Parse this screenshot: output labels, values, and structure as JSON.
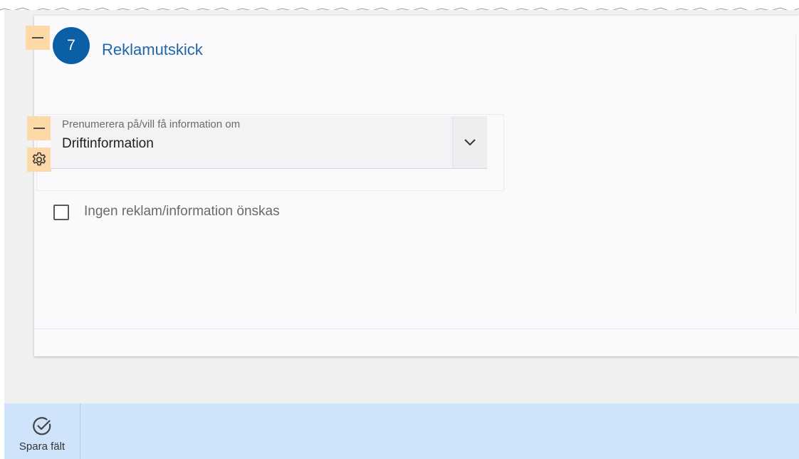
{
  "section": {
    "step_number": "7",
    "title": "Reklamutskick"
  },
  "subscription_select": {
    "label": "Prenumerera på/vill få information om",
    "value": "Driftinformation"
  },
  "opt_out": {
    "label": "Ingen reklam/information önskas",
    "checked": false
  },
  "footer": {
    "save_label": "Spara fält"
  },
  "icons": {
    "collapse_section": "minus-icon",
    "collapse_field": "minus-icon",
    "field_settings": "gear-icon",
    "dropdown": "chevron-down-icon",
    "save": "check-circle-icon"
  },
  "colors": {
    "accent": "#0b5fa5",
    "title": "#1f66a8",
    "edit_handle": "#fcd9a6",
    "footer_bar": "#cfe3fb"
  }
}
